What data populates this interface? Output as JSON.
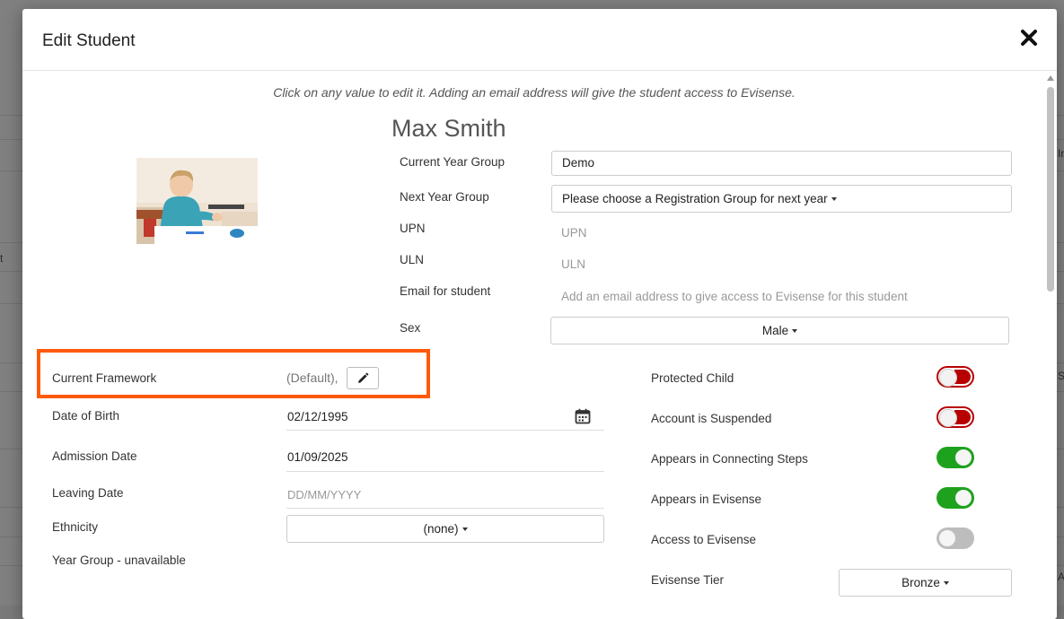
{
  "background": {
    "fragments": {
      "right_top": "In",
      "left_mid": "t",
      "right_mid": "SC",
      "right_bottom": "AJ"
    }
  },
  "modal": {
    "title": "Edit Student",
    "close_icon": "close-icon",
    "hint": "Click on any value to edit it. Adding an email address will give the student access to Evisense.",
    "student_name": "Max Smith"
  },
  "details": {
    "current_year_group": {
      "label": "Current Year Group",
      "value": "Demo"
    },
    "next_year_group": {
      "label": "Next Year Group",
      "value": "Please choose a Registration Group for next year"
    },
    "upn": {
      "label": "UPN",
      "placeholder": "UPN"
    },
    "uln": {
      "label": "ULN",
      "placeholder": "ULN"
    },
    "email": {
      "label": "Email for student",
      "placeholder": "Add an email address to give access to Evisense for this student"
    },
    "sex": {
      "label": "Sex",
      "value": "Male"
    }
  },
  "left": {
    "framework": {
      "label": "Current Framework",
      "value": "(Default),"
    },
    "dob": {
      "label": "Date of Birth",
      "value": "02/12/1995"
    },
    "admission": {
      "label": "Admission Date",
      "value": "01/09/2025"
    },
    "leaving": {
      "label": "Leaving Date",
      "placeholder": "DD/MM/YYYY"
    },
    "ethnicity": {
      "label": "Ethnicity",
      "value": "(none)"
    },
    "year_group": {
      "label": "Year Group - unavailable"
    }
  },
  "right": {
    "protected_child": {
      "label": "Protected Child",
      "state": "off"
    },
    "suspended": {
      "label": "Account is Suspended",
      "state": "off"
    },
    "connecting_steps": {
      "label": "Appears in Connecting Steps",
      "state": "on"
    },
    "appears_evisense": {
      "label": "Appears in Evisense",
      "state": "on"
    },
    "access_evisense": {
      "label": "Access to Evisense",
      "state": "off"
    },
    "tier": {
      "label": "Evisense Tier",
      "value": "Bronze"
    }
  },
  "colors": {
    "highlight": "#ff5a0a",
    "toggle_on": "#1ea21e",
    "toggle_off_red": "#b80000",
    "toggle_off_grey": "#bdbdbd"
  }
}
